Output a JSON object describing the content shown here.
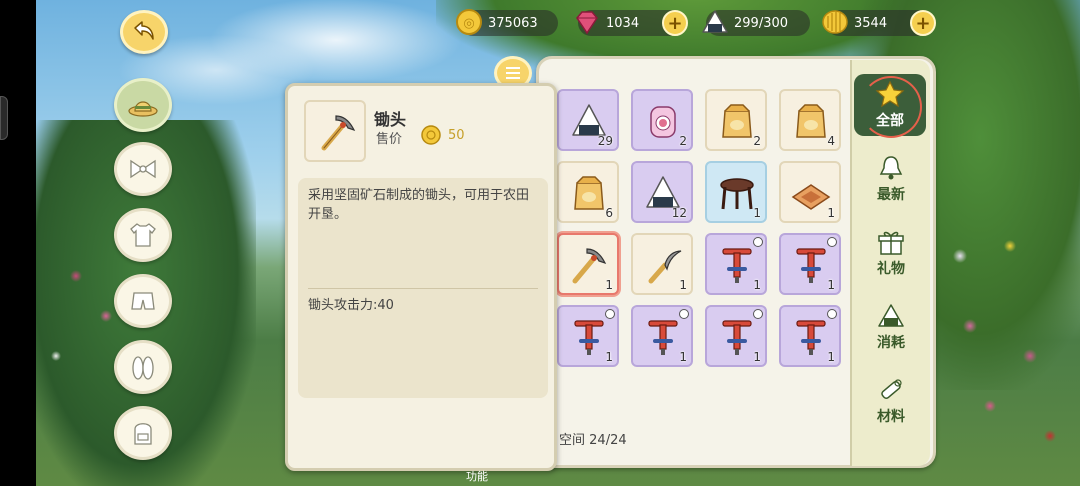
{
  "currency": {
    "gold": "375063",
    "gems": "1034",
    "rice": "299/300",
    "coins": "3544"
  },
  "detail": {
    "item_name": "锄头",
    "price_label": "售价",
    "price": "50",
    "description": "采用坚固矿石制成的锄头，可用于农田开垦。",
    "attribute": "锄头攻击力:40"
  },
  "inventory": {
    "space_label": "空间",
    "space_value": "24/24",
    "slots": [
      {
        "icon": "rice-ball-icon",
        "count": "29",
        "bg": "purple"
      },
      {
        "icon": "jar-icon",
        "count": "2",
        "bg": "purple"
      },
      {
        "icon": "seed-bag-icon",
        "count": "2",
        "bg": "plain"
      },
      {
        "icon": "seed-bag-icon",
        "count": "4",
        "bg": "plain"
      },
      {
        "icon": "seed-bag-icon",
        "count": "6",
        "bg": "plain"
      },
      {
        "icon": "rice-ball-icon",
        "count": "12",
        "bg": "purple"
      },
      {
        "icon": "stool-icon",
        "count": "1",
        "bg": "blue"
      },
      {
        "icon": "rug-icon",
        "count": "1",
        "bg": "plain"
      },
      {
        "icon": "hoe-icon",
        "count": "1",
        "bg": "plain"
      },
      {
        "icon": "sickle-icon",
        "count": "1",
        "bg": "plain"
      },
      {
        "icon": "pogo-stick-icon",
        "count": "1",
        "bg": "purple"
      },
      {
        "icon": "pogo-stick-icon",
        "count": "1",
        "bg": "purple"
      },
      {
        "icon": "pogo-stick-icon",
        "count": "1",
        "bg": "purple"
      },
      {
        "icon": "pogo-stick-icon",
        "count": "1",
        "bg": "purple"
      },
      {
        "icon": "pogo-stick-icon",
        "count": "1",
        "bg": "purple"
      },
      {
        "icon": "pogo-stick-icon",
        "count": "1",
        "bg": "purple"
      }
    ]
  },
  "tabs": [
    {
      "label": "全部",
      "icon": "star-icon"
    },
    {
      "label": "最新",
      "icon": "bell-icon"
    },
    {
      "label": "礼物",
      "icon": "gift-icon"
    },
    {
      "label": "消耗",
      "icon": "rice-ball-icon"
    },
    {
      "label": "材料",
      "icon": "log-icon"
    }
  ],
  "categories": [
    "hat-icon",
    "bow-icon",
    "shirt-icon",
    "shorts-icon",
    "sandals-icon",
    "backpack-icon"
  ],
  "bottom_text": "功能"
}
